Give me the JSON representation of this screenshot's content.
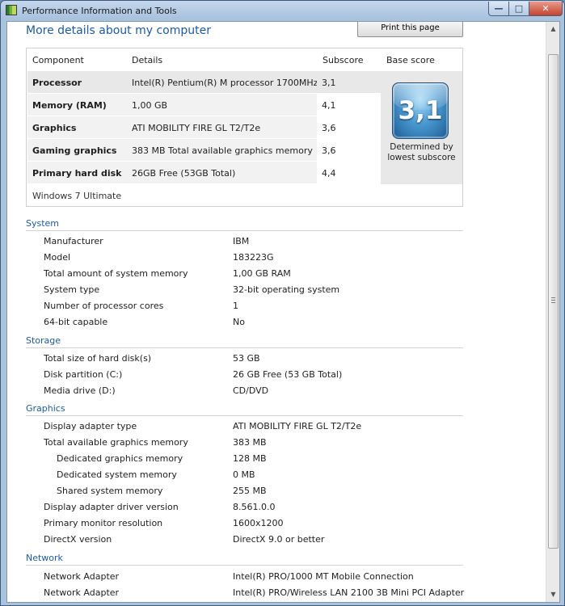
{
  "window": {
    "title": "Performance Information and Tools",
    "min": "—",
    "max": "□",
    "close": "✕"
  },
  "heading": "More details about my computer",
  "print_button": "Print this page",
  "score_table": {
    "headers": [
      "Component",
      "Details",
      "Subscore",
      "Base score"
    ],
    "rows": [
      {
        "component": "Processor",
        "details": "Intel(R) Pentium(R) M processor 1700MHz",
        "subscore": "3,1"
      },
      {
        "component": "Memory (RAM)",
        "details": "1,00 GB",
        "subscore": "4,1"
      },
      {
        "component": "Graphics",
        "details": "ATI MOBILITY FIRE GL T2/T2e",
        "subscore": "3,6"
      },
      {
        "component": "Gaming graphics",
        "details": "383 MB Total available graphics memory",
        "subscore": "3,6"
      },
      {
        "component": "Primary hard disk",
        "details": "26GB Free (53GB Total)",
        "subscore": "4,4"
      }
    ],
    "base_score": "3,1",
    "determined_line1": "Determined by",
    "determined_line2": "lowest subscore",
    "os": "Windows 7 Ultimate"
  },
  "sections": {
    "system": {
      "title": "System",
      "rows": [
        {
          "k": "Manufacturer",
          "v": "IBM"
        },
        {
          "k": "Model",
          "v": "183223G"
        },
        {
          "k": "Total amount of system memory",
          "v": "1,00 GB RAM"
        },
        {
          "k": "System type",
          "v": "32-bit operating system"
        },
        {
          "k": "Number of processor cores",
          "v": "1"
        },
        {
          "k": "64-bit capable",
          "v": "No"
        }
      ]
    },
    "storage": {
      "title": "Storage",
      "rows": [
        {
          "k": "Total size of hard disk(s)",
          "v": "53 GB"
        },
        {
          "k": "Disk partition (C:)",
          "v": "26 GB Free (53 GB Total)"
        },
        {
          "k": "Media drive (D:)",
          "v": "CD/DVD"
        }
      ]
    },
    "graphics": {
      "title": "Graphics",
      "rows": [
        {
          "k": "Display adapter type",
          "v": "ATI MOBILITY FIRE GL T2/T2e"
        },
        {
          "k": "Total available graphics memory",
          "v": "383 MB"
        },
        {
          "k": "Dedicated graphics memory",
          "v": "128 MB"
        },
        {
          "k": "Dedicated system memory",
          "v": "0 MB"
        },
        {
          "k": "Shared system memory",
          "v": "255 MB"
        },
        {
          "k": "Display adapter driver version",
          "v": "8.561.0.0"
        },
        {
          "k": "Primary monitor resolution",
          "v": "1600x1200"
        },
        {
          "k": "DirectX version",
          "v": "DirectX 9.0 or better"
        }
      ]
    },
    "network": {
      "title": "Network",
      "rows": [
        {
          "k": "Network Adapter",
          "v": "Intel(R) PRO/1000 MT Mobile Connection"
        },
        {
          "k": "Network Adapter",
          "v": "Intel(R) PRO/Wireless LAN 2100 3B Mini PCI Adapter"
        }
      ]
    }
  }
}
